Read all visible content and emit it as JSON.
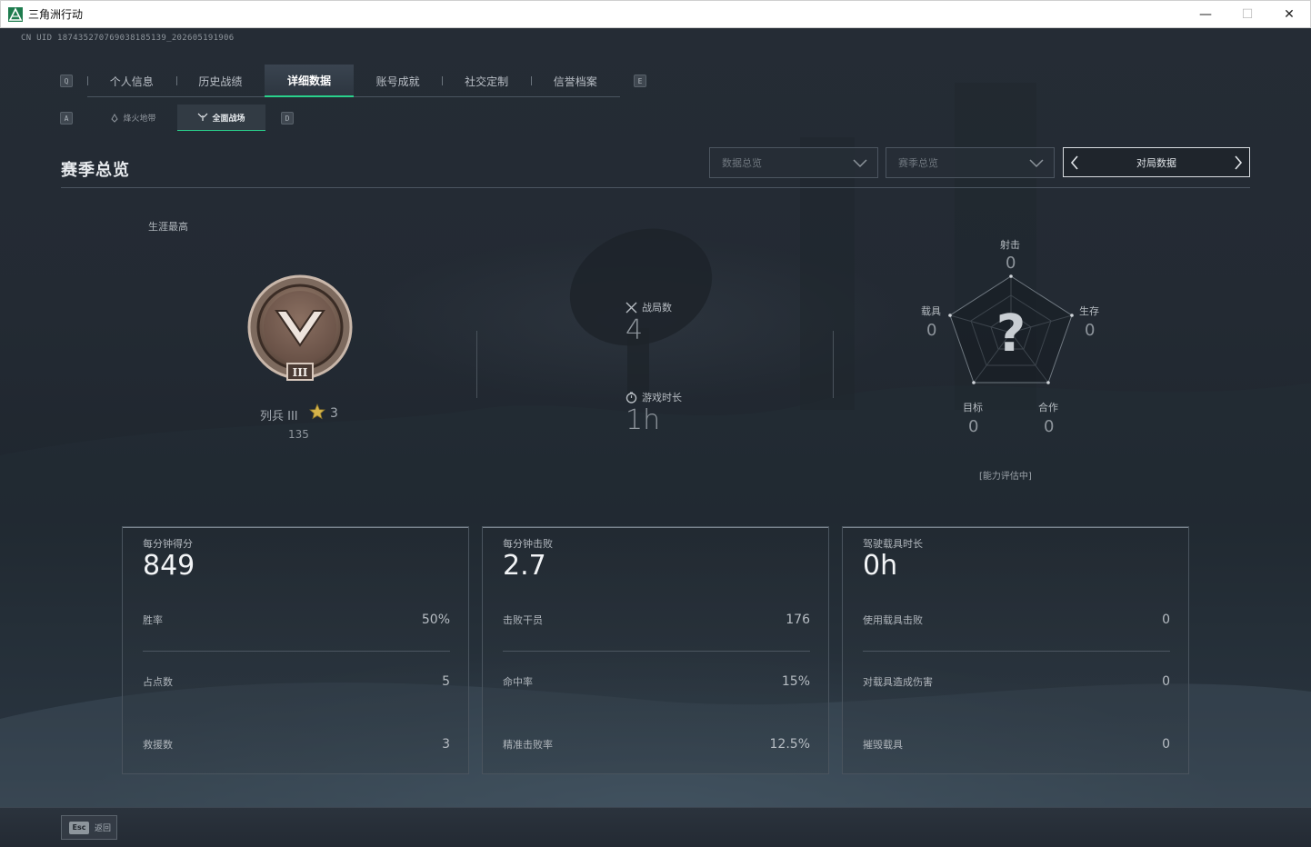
{
  "window": {
    "title": "三角洲行动",
    "minimize_glyph": "—",
    "maximize_glyph": "☐",
    "close_glyph": "✕"
  },
  "uid_text": "CN UID 187435270769038185139_202605191906",
  "key_hints": {
    "prev_tab": "Q",
    "next_tab": "E",
    "prev_sub": "A",
    "next_sub": "D"
  },
  "tabs": [
    {
      "label": "个人信息",
      "active": false
    },
    {
      "label": "历史战绩",
      "active": false
    },
    {
      "label": "详细数据",
      "active": true
    },
    {
      "label": "账号成就",
      "active": false
    },
    {
      "label": "社交定制",
      "active": false
    },
    {
      "label": "信誉档案",
      "active": false
    }
  ],
  "subtabs": [
    {
      "label": "烽火地带",
      "icon": "fire-zone-icon",
      "active": false
    },
    {
      "label": "全面战场",
      "icon": "battlefield-icon",
      "active": true
    }
  ],
  "section": {
    "title": "赛季总览"
  },
  "filters": {
    "data_placeholder": "数据总览",
    "season_placeholder": "赛季总览",
    "match_nav_label": "对局数据"
  },
  "career": {
    "label": "生涯最高",
    "rank_name": "列兵 III",
    "stars": "3",
    "score": "135",
    "badge_numeral": "III"
  },
  "overview": {
    "matches_label": "战局数",
    "matches_value": "4",
    "playtime_label": "游戏时长",
    "playtime_value": "1h"
  },
  "radar": {
    "center_glyph": "?",
    "shooting_label": "射击",
    "shooting_value": "0",
    "survival_label": "生存",
    "survival_value": "0",
    "cooperation_label": "合作",
    "cooperation_value": "0",
    "objective_label": "目标",
    "objective_value": "0",
    "vehicle_label": "载具",
    "vehicle_value": "0",
    "status": "[能力评估中]"
  },
  "cards": [
    {
      "big_label": "每分钟得分",
      "big_value": "849",
      "rows": [
        {
          "k": "胜率",
          "v": "50%"
        },
        {
          "k": "占点数",
          "v": "5"
        },
        {
          "k": "救援数",
          "v": "3"
        }
      ]
    },
    {
      "big_label": "每分钟击败",
      "big_value": "2.7",
      "rows": [
        {
          "k": "击败干员",
          "v": "176"
        },
        {
          "k": "命中率",
          "v": "15%"
        },
        {
          "k": "精准击败率",
          "v": "12.5%"
        }
      ]
    },
    {
      "big_label": "驾驶载具时长",
      "big_value": "0h",
      "rows": [
        {
          "k": "使用载具击败",
          "v": "0"
        },
        {
          "k": "对载具造成伤害",
          "v": "0"
        },
        {
          "k": "摧毁载具",
          "v": "0"
        }
      ]
    }
  ],
  "footer": {
    "esc_key": "Esc",
    "back_label": "返回"
  }
}
